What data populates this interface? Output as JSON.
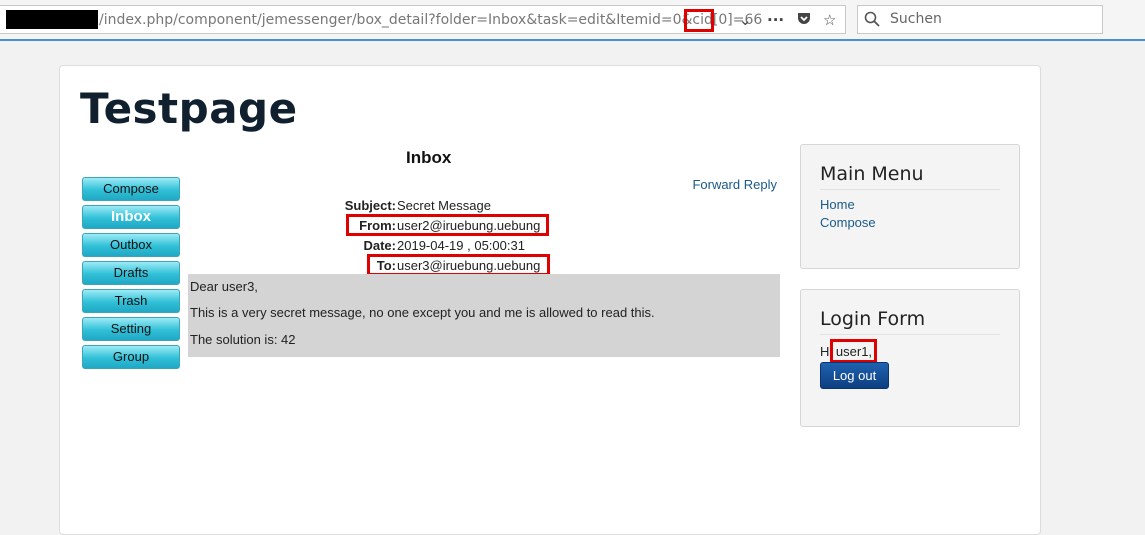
{
  "browser": {
    "url": "/index.php/component/jemessenger/box_detail?folder=Inbox&task=edit&Itemid=0&cid[0]=66",
    "search_placeholder": "Suchen"
  },
  "site": {
    "title": "Testpage"
  },
  "nav": {
    "items": [
      "Compose",
      "Inbox",
      "Outbox",
      "Drafts",
      "Trash",
      "Setting",
      "Group"
    ],
    "active": "Inbox"
  },
  "message": {
    "folder_title": "Inbox",
    "action_forward": "Forward",
    "action_reply": "Reply",
    "subject_label": "Subject:",
    "subject": "Secret Message",
    "from_label": "From:",
    "from": "user2@iruebung.uebung",
    "date_label": "Date:",
    "date": "2019-04-19 , 05:00:31",
    "to_label": "To:",
    "to": "user3@iruebung.uebung",
    "body": [
      "Dear user3,",
      "This is a very secret message, no one except you and me is allowed to read this.",
      "The solution is: 42"
    ]
  },
  "main_menu": {
    "title": "Main Menu",
    "items": [
      "Home",
      "Compose"
    ]
  },
  "login_form": {
    "title": "Login Form",
    "greeting_prefix": "Hi",
    "username": "user1,",
    "logout_label": "Log out"
  },
  "colors": {
    "highlight": "#e00000",
    "nav_button": "#30c0d8",
    "logout_button": "#0d3f82",
    "link": "#1a5a8a"
  }
}
